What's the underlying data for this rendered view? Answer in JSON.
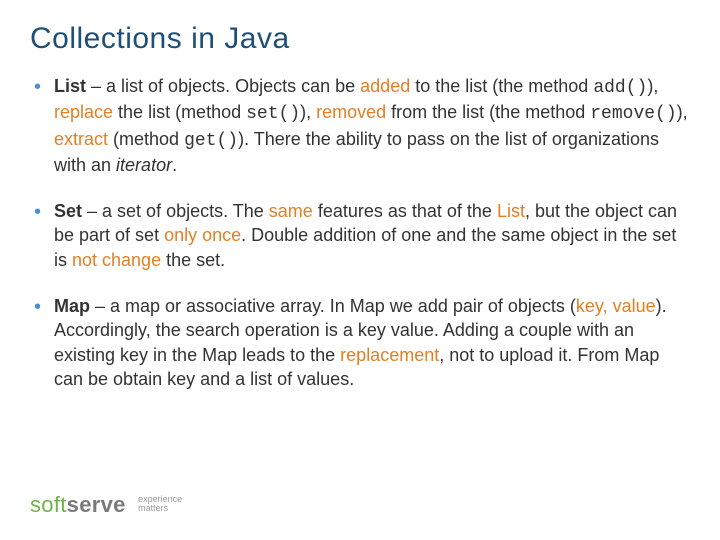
{
  "title": "Collections in Java",
  "bullets": [
    {
      "name": "List",
      "segments": [
        {
          "t": "List",
          "cls": "b"
        },
        {
          "t": " – a list of objects. Objects can be "
        },
        {
          "t": "added",
          "cls": "hl"
        },
        {
          "t": " to the list (the method "
        },
        {
          "t": "add()",
          "cls": "code"
        },
        {
          "t": "), "
        },
        {
          "t": "replace",
          "cls": "hl"
        },
        {
          "t": " the list (method "
        },
        {
          "t": "set()",
          "cls": "code"
        },
        {
          "t": "), "
        },
        {
          "t": "removed",
          "cls": "hl"
        },
        {
          "t": " from the list (the method "
        },
        {
          "t": "remove()",
          "cls": "code"
        },
        {
          "t": "), "
        },
        {
          "t": "extract",
          "cls": "hl"
        },
        {
          "t": " (method "
        },
        {
          "t": "get()",
          "cls": "code"
        },
        {
          "t": "). There the ability to pass on the list of organizations with an "
        },
        {
          "t": "iterator",
          "cls": "it"
        },
        {
          "t": "."
        }
      ]
    },
    {
      "name": "Set",
      "segments": [
        {
          "t": "Set",
          "cls": "b"
        },
        {
          "t": " – a set of objects. The "
        },
        {
          "t": "same",
          "cls": "hl"
        },
        {
          "t": " features as that of the "
        },
        {
          "t": "List",
          "cls": "hl"
        },
        {
          "t": ", but the object can be part of set "
        },
        {
          "t": "only once",
          "cls": "hl"
        },
        {
          "t": ". Double addition of one and the same object in the set is "
        },
        {
          "t": "not change",
          "cls": "hl"
        },
        {
          "t": " the set."
        }
      ]
    },
    {
      "name": "Map",
      "segments": [
        {
          "t": "Map",
          "cls": "b"
        },
        {
          "t": " – a map or associative array. In Map we add pair of objects ("
        },
        {
          "t": "key, value",
          "cls": "hl"
        },
        {
          "t": "). Accordingly, the search operation is a key value. Adding a couple with an existing key in the Map leads to the "
        },
        {
          "t": "replacement",
          "cls": "hl"
        },
        {
          "t": ", not to upload it. From Map can be obtain key and a list of values."
        }
      ]
    }
  ],
  "logo": {
    "soft": "soft",
    "serve": "serve",
    "tag1": "experience",
    "tag2": "matters"
  }
}
